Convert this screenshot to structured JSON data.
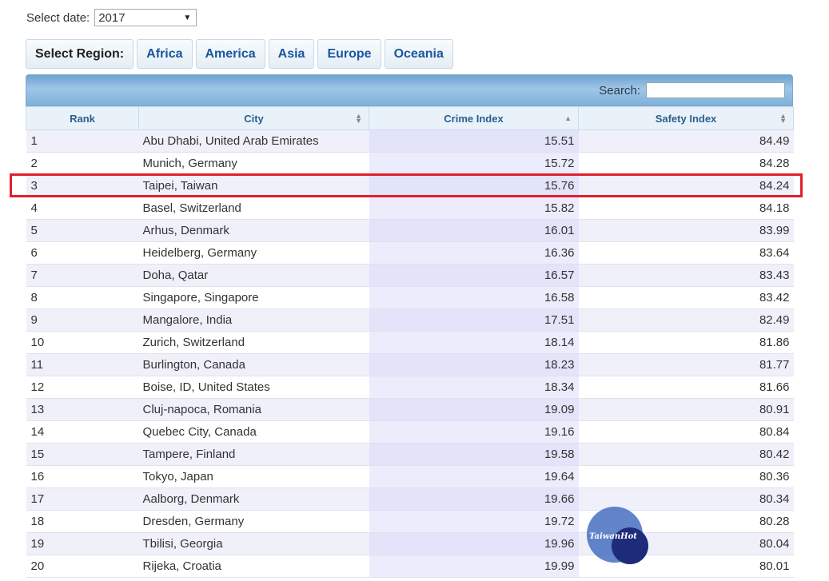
{
  "filters": {
    "date_label": "Select date:",
    "date_value": "2017",
    "region_label": "Select Region:",
    "regions": [
      "Africa",
      "America",
      "Asia",
      "Europe",
      "Oceania"
    ]
  },
  "search": {
    "label": "Search:",
    "value": ""
  },
  "table": {
    "columns": [
      "Rank",
      "City",
      "Crime Index",
      "Safety Index"
    ],
    "rows": [
      {
        "rank": "1",
        "city": "Abu Dhabi, United Arab Emirates",
        "crime": "15.51",
        "safety": "84.49"
      },
      {
        "rank": "2",
        "city": "Munich, Germany",
        "crime": "15.72",
        "safety": "84.28"
      },
      {
        "rank": "3",
        "city": "Taipei, Taiwan",
        "crime": "15.76",
        "safety": "84.24"
      },
      {
        "rank": "4",
        "city": "Basel, Switzerland",
        "crime": "15.82",
        "safety": "84.18"
      },
      {
        "rank": "5",
        "city": "Arhus, Denmark",
        "crime": "16.01",
        "safety": "83.99"
      },
      {
        "rank": "6",
        "city": "Heidelberg, Germany",
        "crime": "16.36",
        "safety": "83.64"
      },
      {
        "rank": "7",
        "city": "Doha, Qatar",
        "crime": "16.57",
        "safety": "83.43"
      },
      {
        "rank": "8",
        "city": "Singapore, Singapore",
        "crime": "16.58",
        "safety": "83.42"
      },
      {
        "rank": "9",
        "city": "Mangalore, India",
        "crime": "17.51",
        "safety": "82.49"
      },
      {
        "rank": "10",
        "city": "Zurich, Switzerland",
        "crime": "18.14",
        "safety": "81.86"
      },
      {
        "rank": "11",
        "city": "Burlington, Canada",
        "crime": "18.23",
        "safety": "81.77"
      },
      {
        "rank": "12",
        "city": "Boise, ID, United States",
        "crime": "18.34",
        "safety": "81.66"
      },
      {
        "rank": "13",
        "city": "Cluj-napoca, Romania",
        "crime": "19.09",
        "safety": "80.91"
      },
      {
        "rank": "14",
        "city": "Quebec City, Canada",
        "crime": "19.16",
        "safety": "80.84"
      },
      {
        "rank": "15",
        "city": "Tampere, Finland",
        "crime": "19.58",
        "safety": "80.42"
      },
      {
        "rank": "16",
        "city": "Tokyo, Japan",
        "crime": "19.64",
        "safety": "80.36"
      },
      {
        "rank": "17",
        "city": "Aalborg, Denmark",
        "crime": "19.66",
        "safety": "80.34"
      },
      {
        "rank": "18",
        "city": "Dresden, Germany",
        "crime": "19.72",
        "safety": "80.28"
      },
      {
        "rank": "19",
        "city": "Tbilisi, Georgia",
        "crime": "19.96",
        "safety": "80.04"
      },
      {
        "rank": "20",
        "city": "Rijeka, Croatia",
        "crime": "19.99",
        "safety": "80.01"
      }
    ]
  },
  "watermark": {
    "text": "TaiwanHot"
  },
  "colors": {
    "highlight": "#e0202a",
    "header_text": "#2a5f8f",
    "region_text": "#1a57a0"
  }
}
